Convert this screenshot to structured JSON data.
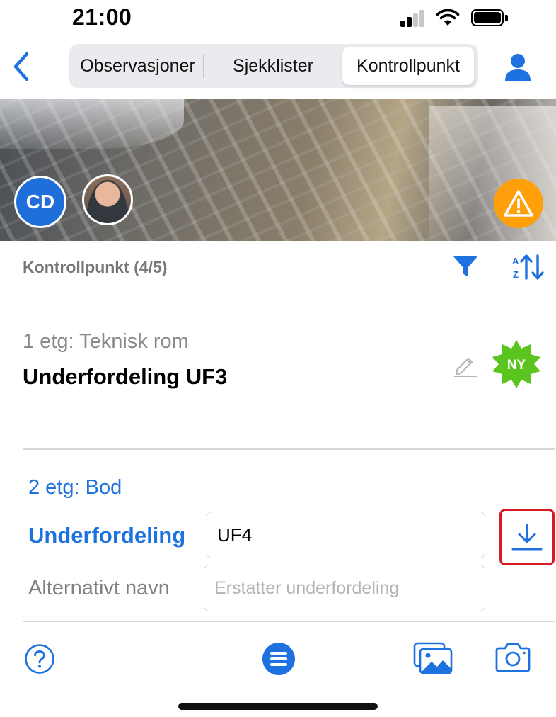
{
  "status_bar": {
    "time": "21:00"
  },
  "nav": {
    "tabs": [
      {
        "label": "Observasjoner"
      },
      {
        "label": "Sjekklister"
      },
      {
        "label": "Kontrollpunkt",
        "selected": true
      }
    ]
  },
  "header": {
    "avatar_initials": "CD"
  },
  "list": {
    "title": "Kontrollpunkt (4/5)"
  },
  "item1": {
    "location": "1 etg: Teknisk rom",
    "name": "Underfordeling UF3",
    "badge": "NY"
  },
  "item2": {
    "location": "2 etg: Bod",
    "field_label": "Underfordeling",
    "field_value": "UF4",
    "alt_label": "Alternativt navn",
    "alt_placeholder": "Erstatter underfordeling"
  },
  "colors": {
    "accent": "#1d72e0",
    "warning": "#ff9f0a",
    "badge_green": "#5cc41e",
    "highlight": "#d81b23"
  },
  "icons": [
    "back-chevron-icon",
    "person-icon",
    "warning-icon",
    "filter-icon",
    "sort-az-icon",
    "pencil-icon",
    "download-icon",
    "help-icon",
    "menu-icon",
    "gallery-icon",
    "camera-icon"
  ]
}
